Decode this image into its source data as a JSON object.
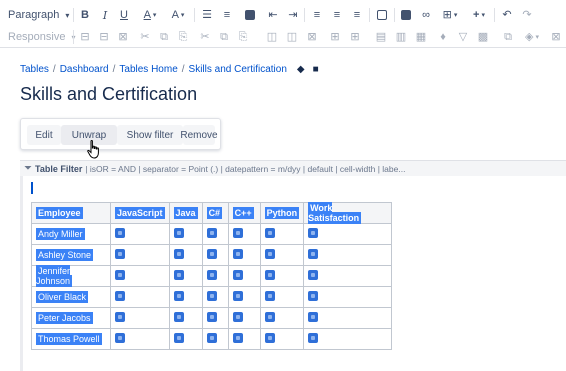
{
  "toolbar": {
    "paragraph_style": "Paragraph",
    "table_layout": "Responsive",
    "icons_row1": [
      "bold-icon",
      "italic-icon",
      "underline-icon",
      "text-color-icon",
      "text-format-icon",
      "bullet-list-icon",
      "numbered-list-icon",
      "task-list-icon",
      "outdent-icon",
      "indent-icon",
      "align-left-icon",
      "align-center-icon",
      "align-right-icon",
      "layout-icon",
      "image-icon",
      "link-icon",
      "table-icon",
      "insert-more-icon",
      "undo-icon",
      "redo-icon"
    ],
    "glyphs": {
      "bold": "B",
      "italic": "I",
      "underline": "U",
      "text_color": "A",
      "text_format": "A",
      "insert_more": "+"
    }
  },
  "breadcrumb": {
    "items": [
      "Tables",
      "Dashboard",
      "Tables Home",
      "Skills and Certification"
    ],
    "separator": "/"
  },
  "page": {
    "title": "Skills and Certification"
  },
  "panel": {
    "buttons": [
      "Edit",
      "Unwrap",
      "Show filter",
      "Remove"
    ]
  },
  "macro": {
    "name": "Table Filter",
    "params": "| isOR = AND | separator = Point (.) | datepattern = m/dyy | default | cell-width | labe..."
  },
  "table": {
    "headers": [
      "Employee",
      "JavaScript",
      "Java",
      "C#",
      "C++",
      "Python",
      "Work Satisfaction"
    ],
    "rows": [
      "Andy Miller",
      "Ashley Stone",
      "Jennifer Johnson",
      "Oliver Black",
      "Peter Jacobs",
      "Thomas Powell"
    ],
    "cell_icon": "status-macro-icon"
  },
  "colors": {
    "link": "#0052cc",
    "selection": "#3b82f6",
    "text": "#172b4d"
  }
}
